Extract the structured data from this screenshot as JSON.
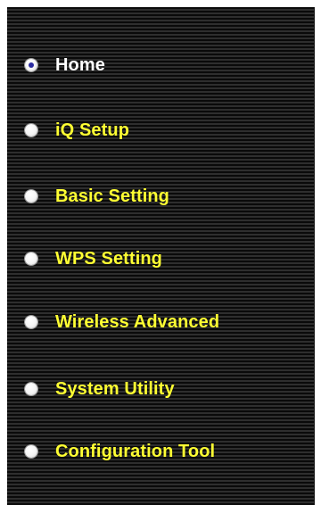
{
  "menu": {
    "items": [
      {
        "label": "Home",
        "selected": true
      },
      {
        "label": "iQ Setup",
        "selected": false
      },
      {
        "label": "Basic Setting",
        "selected": false
      },
      {
        "label": "WPS Setting",
        "selected": false
      },
      {
        "label": "Wireless Advanced",
        "selected": false
      },
      {
        "label": "System Utility",
        "selected": false
      },
      {
        "label": "Configuration Tool",
        "selected": false
      }
    ]
  },
  "colors": {
    "background": "#050505",
    "stripe": "#2e2e2e",
    "label": "#ffff33",
    "active_label": "#ffffff"
  }
}
